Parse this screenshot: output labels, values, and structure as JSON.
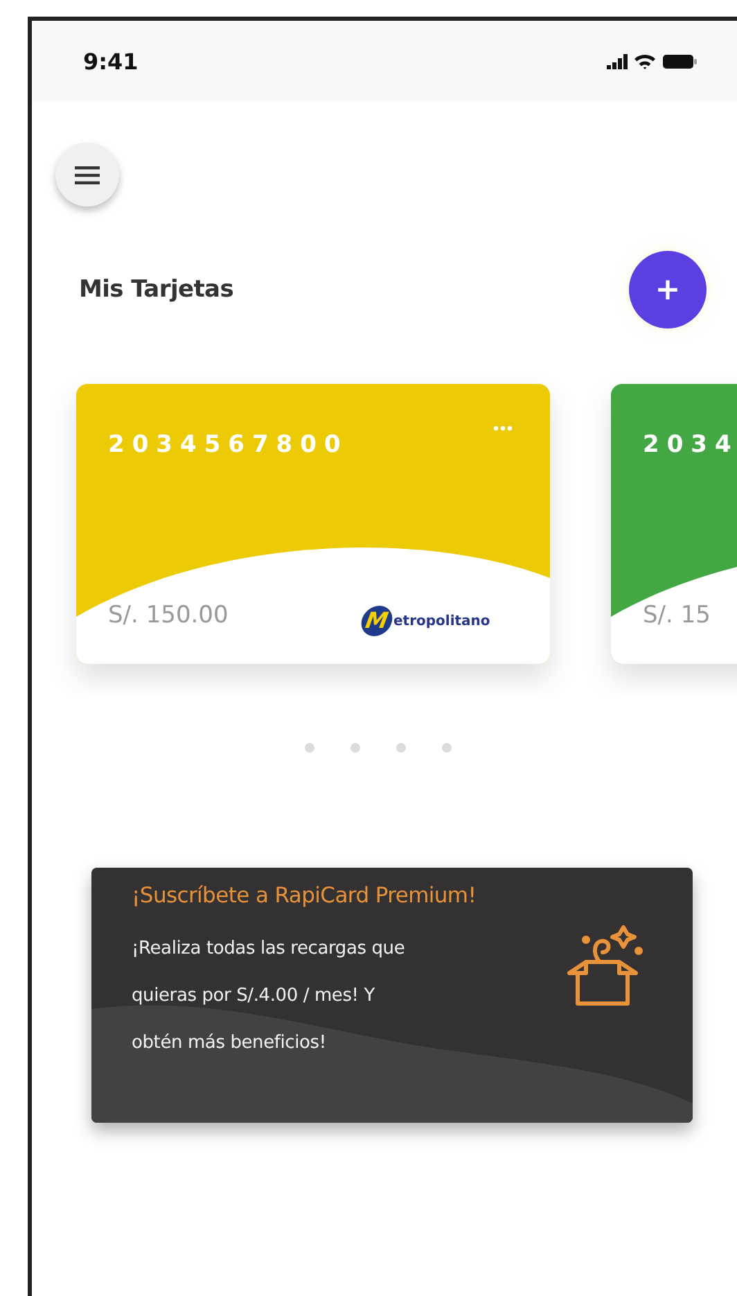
{
  "status_bar": {
    "time": "9:41"
  },
  "header": {
    "title": "Mis Tarjetas",
    "add_button": "+"
  },
  "cards": [
    {
      "number": "2034567800",
      "balance": "S/. 150.00",
      "color": "#eccb06",
      "logo": {
        "mark": "M",
        "text": "etropolitano"
      }
    },
    {
      "number": "2034",
      "balance": "S/. 15",
      "color": "#43a843"
    }
  ],
  "pager": [
    {
      "selected": false
    },
    {
      "selected": false
    },
    {
      "selected": false
    },
    {
      "selected": false
    }
  ],
  "promo": {
    "title": "¡Suscríbete a RapiCard Premium!",
    "lines": [
      "¡Realiza todas las recargas que",
      "quieras por S/.4.00 / mes!  Y",
      "obtén más beneficios!"
    ]
  }
}
